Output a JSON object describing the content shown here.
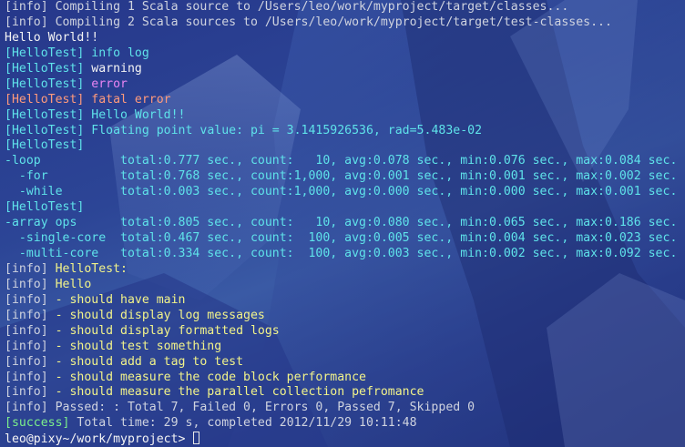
{
  "colors": {
    "info": "#cfd3df",
    "tag": "#5fe3ea",
    "warning_text": "#f4f4f4",
    "error_text": "#e884f2",
    "fatal_text": "#ff9a7c",
    "test_text": "#f2f38a",
    "success": "#7cf08a"
  },
  "terminal": {
    "lines": [
      {
        "prefix": "[info] ",
        "text": "Compiling 1 Scala source to /Users/leo/work/myproject/target/classes..."
      },
      {
        "prefix": "[info] ",
        "text": "Compiling 2 Scala sources to /Users/leo/work/myproject/target/test-classes..."
      },
      {
        "prefix": "",
        "text": "Hello World!!"
      },
      {
        "prefix": "[HelloTest] ",
        "text": "info log"
      },
      {
        "prefix": "[HelloTest] ",
        "text": "warning"
      },
      {
        "prefix": "[HelloTest] ",
        "text": "error"
      },
      {
        "prefix": "[HelloTest] ",
        "text": "fatal error"
      },
      {
        "prefix": "[HelloTest] ",
        "text": "Hello World!!"
      },
      {
        "prefix": "[HelloTest] ",
        "text": "Floating point value: pi = 3.1415926536, rad=5.483e-02"
      },
      {
        "prefix": "[HelloTest]",
        "text": ""
      },
      {
        "prefix": "",
        "text": "-loop           total:0.777 sec., count:   10, avg:0.078 sec., min:0.076 sec., max:0.084 sec."
      },
      {
        "prefix": "",
        "text": "  -for          total:0.768 sec., count:1,000, avg:0.001 sec., min:0.001 sec., max:0.002 sec."
      },
      {
        "prefix": "",
        "text": "  -while        total:0.003 sec., count:1,000, avg:0.000 sec., min:0.000 sec., max:0.001 sec."
      },
      {
        "prefix": "[HelloTest]",
        "text": ""
      },
      {
        "prefix": "",
        "text": "-array ops      total:0.805 sec., count:   10, avg:0.080 sec., min:0.065 sec., max:0.186 sec."
      },
      {
        "prefix": "",
        "text": "  -single-core  total:0.467 sec., count:  100, avg:0.005 sec., min:0.004 sec., max:0.023 sec."
      },
      {
        "prefix": "",
        "text": "  -multi-core   total:0.334 sec., count:  100, avg:0.003 sec., min:0.002 sec., max:0.092 sec."
      },
      {
        "prefix": "[info] ",
        "text": "HelloTest:"
      },
      {
        "prefix": "[info] ",
        "text": "Hello"
      },
      {
        "prefix": "[info] ",
        "text": "- should have main"
      },
      {
        "prefix": "[info] ",
        "text": "- should display log messages"
      },
      {
        "prefix": "[info] ",
        "text": "- should display formatted logs"
      },
      {
        "prefix": "[info] ",
        "text": "- should test something"
      },
      {
        "prefix": "[info] ",
        "text": "- should add a tag to test"
      },
      {
        "prefix": "[info] ",
        "text": "- should measure the code block performance"
      },
      {
        "prefix": "[info] ",
        "text": "- should measure the parallel collection pefromance"
      },
      {
        "prefix": "[info] ",
        "text": "Passed: : Total 7, Failed 0, Errors 0, Passed 7, Skipped 0"
      },
      {
        "prefix": "[success] ",
        "text": "Total time: 29 s, completed 2012/11/29 10:11:48"
      }
    ],
    "prompt": "leo@pixy~/work/myproject> "
  }
}
